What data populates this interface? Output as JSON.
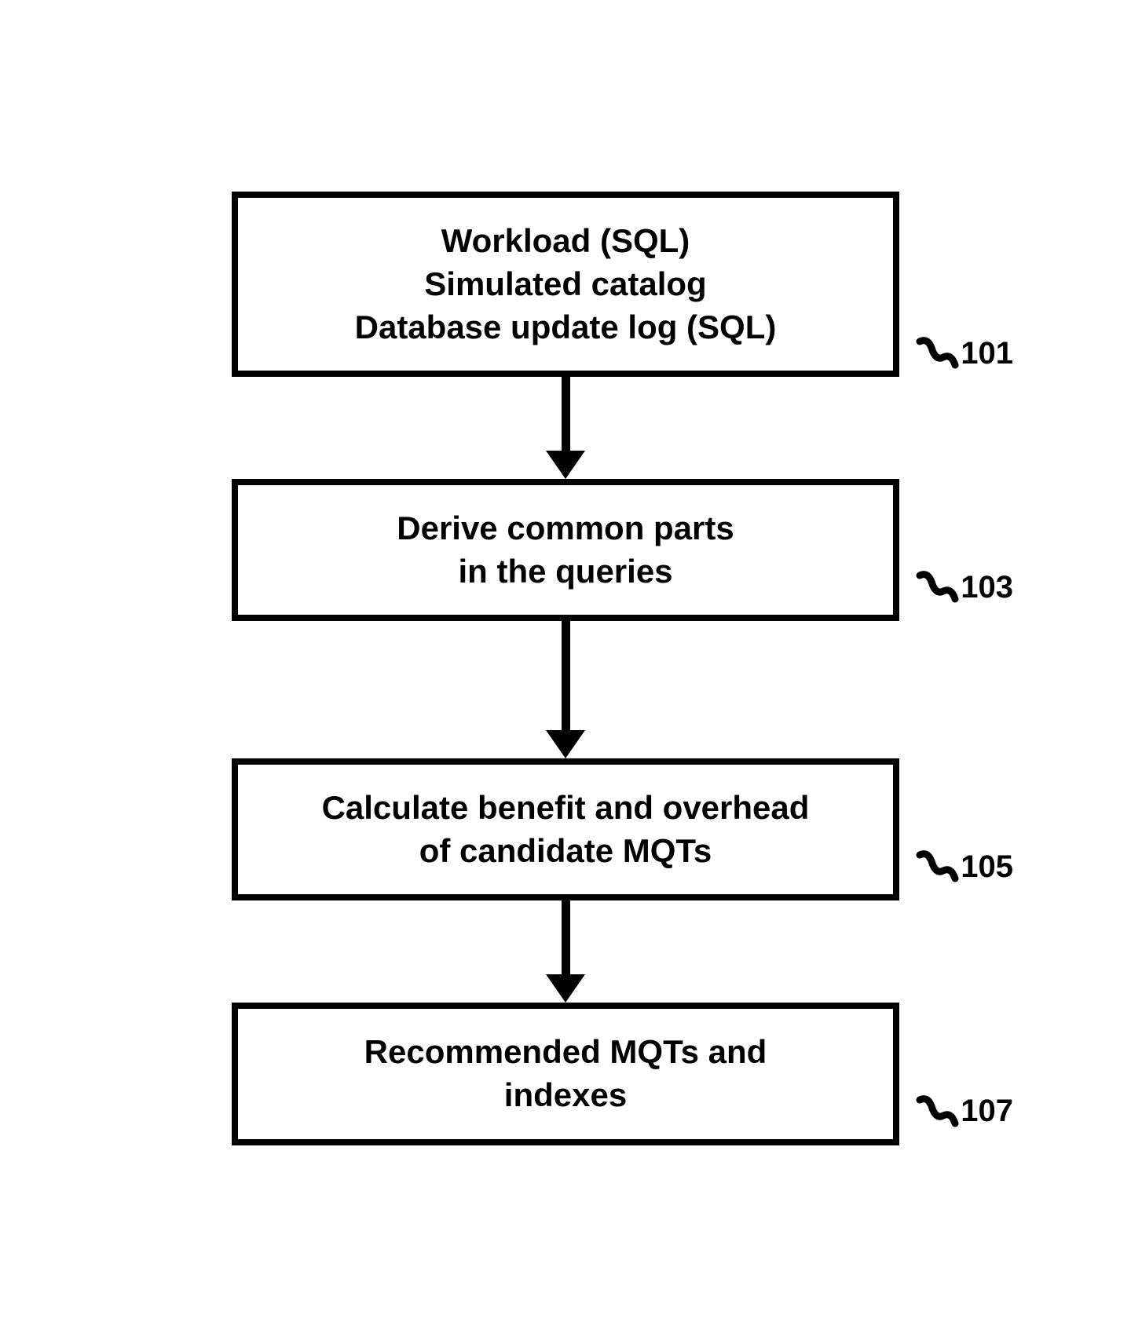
{
  "flowchart": {
    "nodes": [
      {
        "id": "101",
        "lines": [
          "Workload (SQL)",
          "Simulated catalog",
          "Database update log (SQL)"
        ]
      },
      {
        "id": "103",
        "lines": [
          "Derive common parts",
          "in the queries"
        ]
      },
      {
        "id": "105",
        "lines": [
          "Calculate benefit and overhead",
          "of candidate MQTs"
        ]
      },
      {
        "id": "107",
        "lines": [
          "Recommended MQTs and",
          "indexes"
        ]
      }
    ]
  }
}
